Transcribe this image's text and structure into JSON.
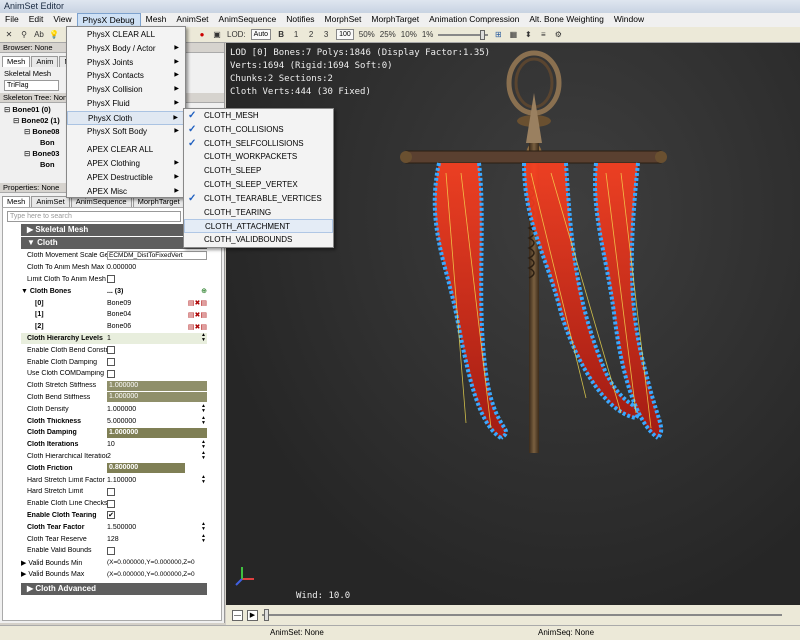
{
  "window": {
    "title": "AnimSet Editor"
  },
  "menubar": [
    "File",
    "Edit",
    "View",
    "PhysX Debug",
    "Mesh",
    "AnimSet",
    "AnimSequence",
    "Notifies",
    "MorphSet",
    "MorphTarget",
    "Animation Compression",
    "Alt. Bone Weighting",
    "Window"
  ],
  "toolbar": {
    "lod_label": "LOD:",
    "lod_auto": "Auto",
    "lod_base": "B",
    "lod_1": "1",
    "lod_2": "2",
    "lod_3": "3",
    "speed_100": "100",
    "speed_50": "50%",
    "speed_25": "25%",
    "speed_10": "10%",
    "speed_1": "1%"
  },
  "browser": {
    "header": "Browser: None",
    "tabs": [
      "Mesh",
      "Anim",
      "Mo"
    ],
    "label": "Skeletal Mesh",
    "field": "TriFlag"
  },
  "skeleton": {
    "header": "Skeleton Tree: None",
    "rows": [
      "Bone01 (0)",
      "Bone02 (1)",
      "Bone08",
      "Bon",
      "Bone03",
      "Bon"
    ]
  },
  "properties": {
    "header": "Properties: None",
    "tabs": [
      "Mesh",
      "AnimSet",
      "AnimSequence",
      "MorphTarget"
    ],
    "search_placeholder": "Type here to search",
    "cat_skeletal": "Skeletal Mesh",
    "cat_cloth": "Cloth",
    "cat_cloth_adv": "Cloth Advanced",
    "rows": [
      {
        "label": "Cloth Movement Scale Gen Mode",
        "value": "ECMDM_DistToFixedVert"
      },
      {
        "label": "Cloth To Anim Mesh Max Dist",
        "value": "0.000000"
      },
      {
        "label": "Limit Cloth To Anim Mesh",
        "value": ""
      },
      {
        "label": "Cloth Bones",
        "value": "... (3)"
      },
      {
        "label": "[0]",
        "value": "Bone09"
      },
      {
        "label": "[1]",
        "value": "Bone04"
      },
      {
        "label": "[2]",
        "value": "Bone06"
      },
      {
        "label": "Cloth Hierarchy Levels",
        "value": "1"
      },
      {
        "label": "Enable Cloth Bend Constraints",
        "value": ""
      },
      {
        "label": "Enable Cloth Damping",
        "value": ""
      },
      {
        "label": "Use Cloth COMDamping",
        "value": ""
      },
      {
        "label": "Cloth Stretch Stiffness",
        "value": "1.000000"
      },
      {
        "label": "Cloth Bend Stiffness",
        "value": "1.000000"
      },
      {
        "label": "Cloth Density",
        "value": "1.000000"
      },
      {
        "label": "Cloth Thickness",
        "value": "5.000000"
      },
      {
        "label": "Cloth Damping",
        "value": "1.000000"
      },
      {
        "label": "Cloth Iterations",
        "value": "10"
      },
      {
        "label": "Cloth Hierarchical Iterations",
        "value": "2"
      },
      {
        "label": "Cloth Friction",
        "value": "0.800000"
      },
      {
        "label": "Hard Stretch Limit Factor",
        "value": "1.100000"
      },
      {
        "label": "Hard Stretch Limit",
        "value": ""
      },
      {
        "label": "Enable Cloth Line Checks",
        "value": ""
      },
      {
        "label": "Enable Cloth Tearing",
        "value": ""
      },
      {
        "label": "Cloth Tear Factor",
        "value": "1.500000"
      },
      {
        "label": "Cloth Tear Reserve",
        "value": "128"
      },
      {
        "label": "Enable Valid Bounds",
        "value": ""
      },
      {
        "label": "Valid Bounds Min",
        "value": "(X=0.000000,Y=0.000000,Z=0"
      },
      {
        "label": "Valid Bounds Max",
        "value": "(X=0.000000,Y=0.000000,Z=0"
      }
    ]
  },
  "viewport": {
    "info1": "LOD [0] Bones:7 Polys:1846 (Display Factor:1.35)",
    "info2": "Verts:1694 (Rigid:1694 Soft:0)",
    "info3": "Chunks:2 Sections:2",
    "info4": "Cloth Verts:444 (30 Fixed)",
    "wind": "Wind: 10.0"
  },
  "physx_menu": {
    "items": [
      "PhysX CLEAR ALL",
      "PhysX Body / Actor",
      "PhysX Joints",
      "PhysX Contacts",
      "PhysX Collision",
      "PhysX Fluid",
      "PhysX Cloth",
      "PhysX Soft Body",
      "APEX CLEAR ALL",
      "APEX Clothing",
      "APEX Destructible",
      "APEX Misc"
    ]
  },
  "cloth_menu": {
    "items": [
      "CLOTH_MESH",
      "CLOTH_COLLISIONS",
      "CLOTH_SELFCOLLISIONS",
      "CLOTH_WORKPACKETS",
      "CLOTH_SLEEP",
      "CLOTH_SLEEP_VERTEX",
      "CLOTH_TEARABLE_VERTICES",
      "CLOTH_TEARING",
      "CLOTH_ATTACHMENT",
      "CLOTH_VALIDBOUNDS"
    ]
  },
  "status": {
    "animset": "AnimSet: None",
    "animseq": "AnimSeq: None"
  }
}
